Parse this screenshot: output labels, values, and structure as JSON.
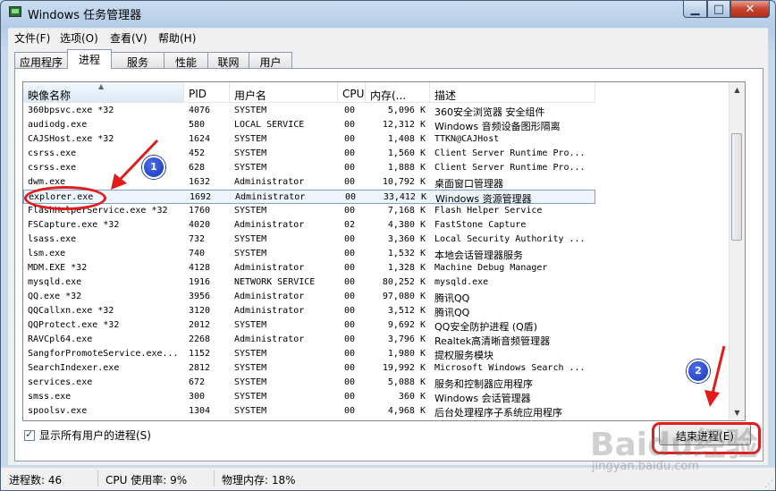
{
  "window": {
    "title": "Windows 任务管理器"
  },
  "menu": [
    "文件(F)",
    "选项(O)",
    "查看(V)",
    "帮助(H)"
  ],
  "tabs": [
    "应用程序",
    "进程",
    "服务",
    "性能",
    "联网",
    "用户"
  ],
  "active_tab": "进程",
  "columns": [
    "映像名称",
    "PID",
    "用户名",
    "CPU",
    "内存(...",
    "描述"
  ],
  "processes": [
    {
      "name": "360bpsvc.exe *32",
      "pid": "4076",
      "user": "SYSTEM",
      "cpu": "00",
      "mem": "5,096 K",
      "desc": "360安全浏览器 安全组件"
    },
    {
      "name": "audiodg.exe",
      "pid": "580",
      "user": "LOCAL SERVICE",
      "cpu": "00",
      "mem": "12,312 K",
      "desc": "Windows 音频设备图形隔离"
    },
    {
      "name": "CAJSHost.exe *32",
      "pid": "1624",
      "user": "SYSTEM",
      "cpu": "00",
      "mem": "1,408 K",
      "desc": "TTKN@CAJHost"
    },
    {
      "name": "csrss.exe",
      "pid": "452",
      "user": "SYSTEM",
      "cpu": "00",
      "mem": "1,560 K",
      "desc": "Client Server Runtime Pro..."
    },
    {
      "name": "csrss.exe",
      "pid": "628",
      "user": "SYSTEM",
      "cpu": "00",
      "mem": "1,888 K",
      "desc": "Client Server Runtime Pro..."
    },
    {
      "name": "dwm.exe",
      "pid": "1632",
      "user": "Administrator",
      "cpu": "00",
      "mem": "10,792 K",
      "desc": "桌面窗口管理器"
    },
    {
      "name": "explorer.exe",
      "pid": "1692",
      "user": "Administrator",
      "cpu": "00",
      "mem": "33,412 K",
      "desc": "Windows 资源管理器"
    },
    {
      "name": "FlashHelperService.exe *32",
      "pid": "1760",
      "user": "SYSTEM",
      "cpu": "00",
      "mem": "7,168 K",
      "desc": "Flash Helper Service"
    },
    {
      "name": "FSCapture.exe *32",
      "pid": "4020",
      "user": "Administrator",
      "cpu": "02",
      "mem": "4,380 K",
      "desc": "FastStone Capture"
    },
    {
      "name": "lsass.exe",
      "pid": "732",
      "user": "SYSTEM",
      "cpu": "00",
      "mem": "3,360 K",
      "desc": "Local Security Authority ..."
    },
    {
      "name": "lsm.exe",
      "pid": "740",
      "user": "SYSTEM",
      "cpu": "00",
      "mem": "1,532 K",
      "desc": "本地会话管理器服务"
    },
    {
      "name": "MDM.EXE *32",
      "pid": "4128",
      "user": "Administrator",
      "cpu": "00",
      "mem": "1,328 K",
      "desc": "Machine Debug Manager"
    },
    {
      "name": "mysqld.exe",
      "pid": "1916",
      "user": "NETWORK SERVICE",
      "cpu": "00",
      "mem": "80,252 K",
      "desc": "mysqld.exe"
    },
    {
      "name": "QQ.exe *32",
      "pid": "3956",
      "user": "Administrator",
      "cpu": "00",
      "mem": "97,080 K",
      "desc": "腾讯QQ"
    },
    {
      "name": "QQCallxn.exe *32",
      "pid": "3120",
      "user": "Administrator",
      "cpu": "00",
      "mem": "3,512 K",
      "desc": "腾讯QQ"
    },
    {
      "name": "QQProtect.exe *32",
      "pid": "2012",
      "user": "SYSTEM",
      "cpu": "00",
      "mem": "9,692 K",
      "desc": "QQ安全防护进程 (Q盾)"
    },
    {
      "name": "RAVCpl64.exe",
      "pid": "2268",
      "user": "Administrator",
      "cpu": "00",
      "mem": "3,796 K",
      "desc": "Realtek高清晰音频管理器"
    },
    {
      "name": "SangforPromoteService.exe...",
      "pid": "1152",
      "user": "SYSTEM",
      "cpu": "00",
      "mem": "1,980 K",
      "desc": "提权服务模块"
    },
    {
      "name": "SearchIndexer.exe",
      "pid": "2812",
      "user": "SYSTEM",
      "cpu": "00",
      "mem": "19,992 K",
      "desc": "Microsoft Windows Search ..."
    },
    {
      "name": "services.exe",
      "pid": "672",
      "user": "SYSTEM",
      "cpu": "00",
      "mem": "5,088 K",
      "desc": "服务和控制器应用程序"
    },
    {
      "name": "smss.exe",
      "pid": "300",
      "user": "SYSTEM",
      "cpu": "00",
      "mem": "360 K",
      "desc": "Windows 会话管理器"
    },
    {
      "name": "spoolsv.exe",
      "pid": "1304",
      "user": "SYSTEM",
      "cpu": "00",
      "mem": "4,968 K",
      "desc": "后台处理程序子系统应用程序"
    }
  ],
  "selected_row": 6,
  "show_all_users": {
    "label": "显示所有用户的进程(S)",
    "checked": true
  },
  "end_process_button": "结束进程(E)",
  "status": {
    "processes": "进程数: 46",
    "cpu": "CPU 使用率: 9%",
    "memory": "物理内存: 18%"
  },
  "annotations": {
    "badge1": "1",
    "badge2": "2",
    "color": "#e21b1b",
    "badge_color": "#1437b5"
  },
  "watermark": {
    "logo": "Baidu经验",
    "url": "jingyan.baidu.com"
  }
}
